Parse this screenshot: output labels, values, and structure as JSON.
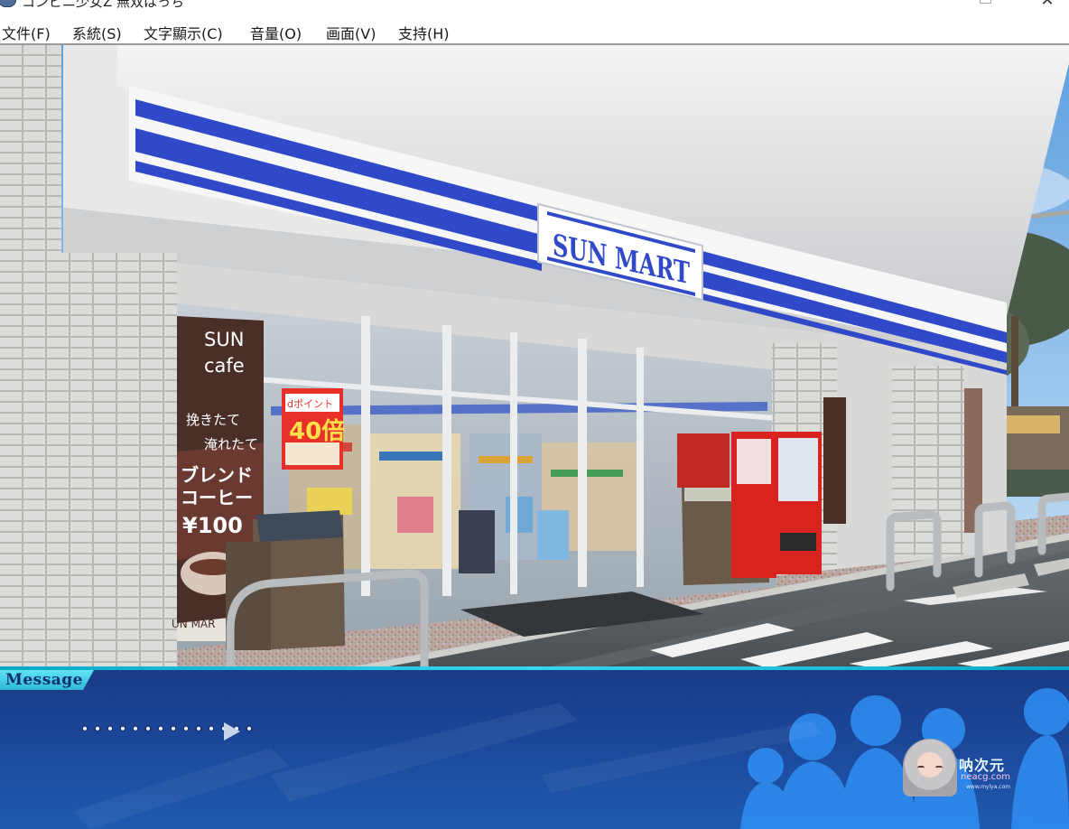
{
  "window": {
    "title": "コンビニ少女Z 無双はっち",
    "maximize_symbol": "",
    "close_symbol": "✕"
  },
  "menu": {
    "items": [
      {
        "label": "文件(F)"
      },
      {
        "label": "系統(S)"
      },
      {
        "label": "文字顯示(C)"
      },
      {
        "label": "音量(O)"
      },
      {
        "label": "画面(V)"
      },
      {
        "label": "支持(H)"
      }
    ]
  },
  "scene": {
    "store_sign": "SUN MART",
    "banner": {
      "line1": "SUN",
      "line2": "cafe",
      "line3": "挽きたて",
      "line4": "淹れたて",
      "line5": "ブレンド",
      "line6": "コーヒー",
      "price": "¥100",
      "footer": "UN MAR"
    },
    "poster": {
      "top": "dポイント",
      "big": "40倍"
    }
  },
  "message_window": {
    "tab_label": "Message",
    "text": "・・・・・・・・・・・・・・"
  },
  "watermark": {
    "name": "呐次元",
    "url": "neacg.com",
    "url2": "www.mylya.com"
  },
  "colors": {
    "sign_blue": "#2f49c8",
    "sky": "#7fb6e8",
    "message_bg": "#1b4596",
    "tab_cyan": "#37d6ef"
  }
}
